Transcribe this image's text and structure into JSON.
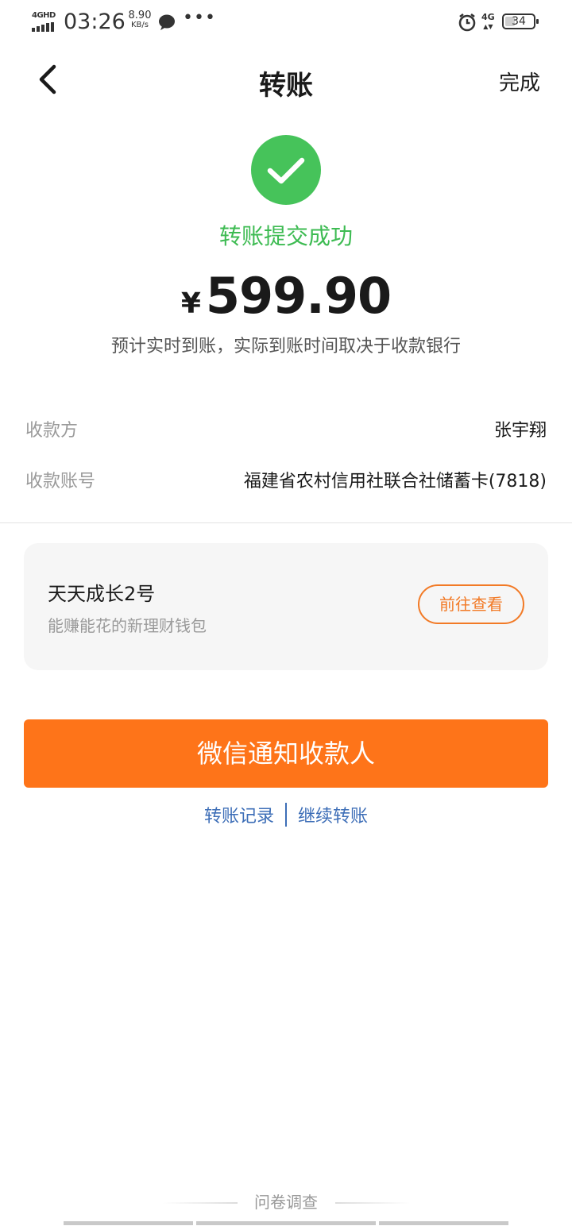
{
  "status_bar": {
    "network_label": "4GHD",
    "time": "03:26",
    "speed_value": "8.90",
    "speed_unit": "KB/s",
    "dots": "•••",
    "cellular": "4G",
    "battery": "34",
    "battery_level": 0.34
  },
  "header": {
    "title": "转账",
    "done_label": "完成"
  },
  "result": {
    "status_text": "转账提交成功",
    "currency": "¥",
    "amount": "599.90",
    "note": "预计实时到账，实际到账时间取决于收款银行",
    "success_color": "#46c35a"
  },
  "details": [
    {
      "label": "收款方",
      "value": "张宇翔"
    },
    {
      "label": "收款账号",
      "value": "福建省农村信用社联合社储蓄卡(7818)"
    }
  ],
  "promo": {
    "title": "天天成长2号",
    "subtitle": "能赚能花的新理财钱包",
    "button_label": "前往查看",
    "accent_color": "#f27a26"
  },
  "actions": {
    "primary_label": "微信通知收款人",
    "primary_color": "#fe7419",
    "link_records": "转账记录",
    "link_continue": "继续转账",
    "link_color": "#3d6eb7"
  },
  "survey": {
    "label": "问卷调查"
  }
}
